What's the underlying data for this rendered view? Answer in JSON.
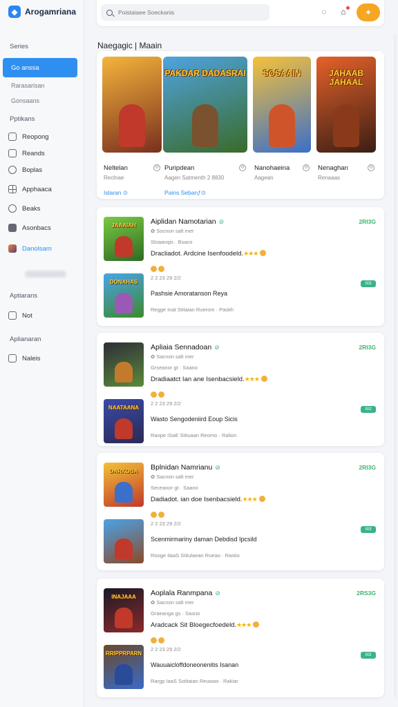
{
  "brand": {
    "name": "Arogamriana"
  },
  "sidebar": {
    "section1": "Series",
    "active_item": "Go anssa",
    "sub_items": [
      "Rarasarisan",
      "Gonsaans"
    ],
    "section2": "Pptikans",
    "items": [
      {
        "label": "Reopong",
        "icon": "bag-icon"
      },
      {
        "label": "Reands",
        "icon": "lock-icon"
      },
      {
        "label": "Boplas",
        "icon": "search-icon"
      },
      {
        "label": "Apphaaca",
        "icon": "grid-icon"
      },
      {
        "label": "Beaks",
        "icon": "compass-icon"
      },
      {
        "label": "Asonbacs",
        "icon": "book-icon"
      },
      {
        "label": "Danolsam",
        "icon": "game-thumb-icon"
      }
    ],
    "section3": "Aptiarans",
    "item_not": "Not",
    "section4": "Aplianaran",
    "item_naleis": "Naleis"
  },
  "topbar": {
    "search_placeholder": "Poistaiaee Soeckanis",
    "orange_button_icon": "bolt-icon"
  },
  "featured": {
    "title": "Naegagic | Maain",
    "games": [
      {
        "art_text": "",
        "name": "Neltelan",
        "sub": "Reclnae",
        "link": "Islaran ⊙",
        "art_colors": [
          "#f4b43c",
          "#7a2f1e"
        ],
        "fig": "#c0392b"
      },
      {
        "art_text": "PAKDAR DADASRAI",
        "name": "Puripdean",
        "sub": "Aagen Satmenth 2 8830",
        "link": "Pains Sebanƒ⊙",
        "art_colors": [
          "#4fa3e0",
          "#3a6b2a"
        ],
        "fig": "#7a5230"
      },
      {
        "art_text": "SOSAAIN",
        "name": "Nanohaeina",
        "sub": "Aagean",
        "link": "",
        "art_colors": [
          "#f5c13a",
          "#3b6fc9"
        ],
        "fig": "#d0542a"
      },
      {
        "art_text": "JAHAAB JAHAAL",
        "name": "Nenaghan",
        "sub": "Renaaas",
        "link": "",
        "art_colors": [
          "#e4622a",
          "#3b1e14"
        ],
        "fig": "#8a3a1a"
      }
    ]
  },
  "list": [
    {
      "title": "Aiplidan Namotarian",
      "meta1": "✿ Socnon salt mer",
      "meta2": "Stsaanqis · Bsaco",
      "desc": "Dracliadot. Ardcine Isenfoodeld.",
      "stat": "2RI3G",
      "date": "2 2 23 29 2/2",
      "badge": "III3",
      "sub": "Pashsie Amoratanson Reya",
      "foot": "Regge Inat Stitaian   Ruerom ·  Paskh",
      "thumbs": [
        {
          "text": "JAAAIAH",
          "c": [
            "#7ac943",
            "#2e6b24"
          ],
          "f": "#c0392b"
        },
        {
          "text": "DONAHAS",
          "c": [
            "#4aa3e8",
            "#3d8a2c"
          ],
          "f": "#9b59b6"
        }
      ]
    },
    {
      "title": "Apliaia Sennadoan",
      "meta1": "✿ Sacnon salt mer",
      "meta2": "Grseanor gt · Saano",
      "desc": "Dradiaatct Ian ane Isenbacsield.",
      "stat": "2RI3G",
      "date": "2 2 23 29 2/2",
      "badge": "III2",
      "sub": "Wasto Sengodeniird Eoup Sicis",
      "foot": "Raope ISaE Stituaan   Reomo ·  Ralion",
      "thumbs": [
        {
          "text": "",
          "c": [
            "#2e2e38",
            "#5a8a3a"
          ],
          "f": "#c47a2c"
        },
        {
          "text": "NAATAANA",
          "c": [
            "#3a4aa8",
            "#2a2a55"
          ],
          "f": "#c0392b"
        }
      ]
    },
    {
      "title": "Bplnidan Namrianu",
      "meta1": "✿ Sacnon salt mer",
      "meta2": "Seceanor gt · Saano",
      "desc": "Dadiadot. ian doe Isenbacsield.",
      "stat": "2RI3G",
      "date": "2 2 23 29 2/2",
      "badge": "III3",
      "sub": "Scenmirmariny daman Debdisd Ipcsild",
      "foot": "Rooge IlaaS Stitulaean   Rueao ·  Rastio",
      "thumbs": [
        {
          "text": "DARKOBA",
          "c": [
            "#f3c13a",
            "#c0392b"
          ],
          "f": "#3b6fc9"
        },
        {
          "text": "",
          "c": [
            "#4aa3e8",
            "#8a4a2a"
          ],
          "f": "#c0392b"
        }
      ]
    },
    {
      "title": "Aoplala Ranmpana",
      "meta1": "✿ Sacnon salt mer",
      "meta2": "Graeanga gs · Sasno",
      "desc": "Aradcack Sit Bloegecfoedeld.",
      "stat": "2RS3G",
      "date": "2 2 23 29 2/2",
      "badge": "III2",
      "sub": "Wauuaicloffdoneonenitis Isanan",
      "foot": "Rargp IaaS Sstitaian   Reuwao ·  Rakiar",
      "thumbs": [
        {
          "text": "INAJAAA",
          "c": [
            "#1a1a28",
            "#8a2a2a"
          ],
          "f": "#c0392b"
        },
        {
          "text": "RRIPPRPARN",
          "c": [
            "#6a4a2a",
            "#3a6ac8"
          ],
          "f": "#2a4a9a"
        }
      ]
    }
  ]
}
